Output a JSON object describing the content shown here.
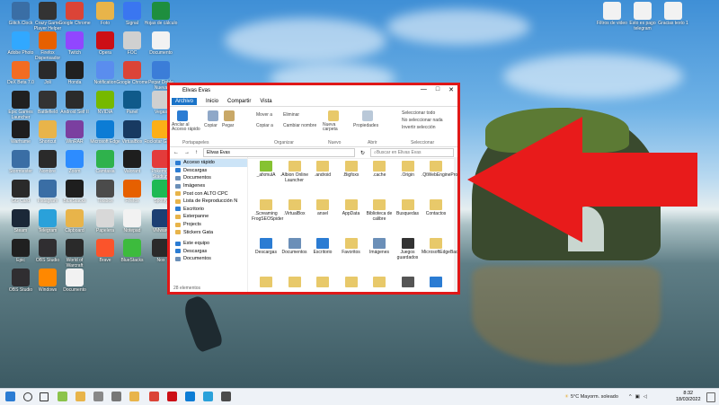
{
  "desktop": {
    "icons": [
      {
        "label": "Glitch.Clock",
        "color": "#3a6ea5"
      },
      {
        "label": "Crazy Game Player Helper",
        "color": "#333333"
      },
      {
        "label": "Google Chrome",
        "color": "#db4437"
      },
      {
        "label": "Foto",
        "color": "#e8b44a"
      },
      {
        "label": "Signal",
        "color": "#3a76f0"
      },
      {
        "label": "Hojas de cálculo",
        "color": "#1e8e3e"
      },
      {
        "label": "Adobe Photo",
        "color": "#31a8ff"
      },
      {
        "label": "Firefox Dispensador",
        "color": "#e66000"
      },
      {
        "label": "Twitch",
        "color": "#9146ff"
      },
      {
        "label": "Opera",
        "color": "#cc0f16"
      },
      {
        "label": "FOC",
        "color": "#d0d0d0"
      },
      {
        "label": "Documento",
        "color": "#f2f2f2"
      },
      {
        "label": "DeX Beta 7.0",
        "color": "#f26c22"
      },
      {
        "label": "Joli",
        "color": "#2a2a2a"
      },
      {
        "label": "Honda",
        "color": "#202020"
      },
      {
        "label": "Notification",
        "color": "#5a8dee"
      },
      {
        "label": "Google Chrome",
        "color": "#db4437"
      },
      {
        "label": "Pegar Doble Nueva",
        "color": "#3b7dd8"
      },
      {
        "label": "Epic Games Launcher",
        "color": "#202020"
      },
      {
        "label": "Battlefield",
        "color": "#333333"
      },
      {
        "label": "Android Self II",
        "color": "#2b2b2b"
      },
      {
        "label": "NVIDIA",
        "color": "#76b900"
      },
      {
        "label": "Panel",
        "color": "#0f5a8a"
      },
      {
        "label": "Vegas",
        "color": "#d0d0d0"
      },
      {
        "label": "Warframe",
        "color": "#1e1e1e"
      },
      {
        "label": "Shortcut",
        "color": "#e8b44a"
      },
      {
        "label": "WinRAR",
        "color": "#7b3fa0"
      },
      {
        "label": "Microsoft Edge",
        "color": "#0c7cd5"
      },
      {
        "label": "VirtualBox",
        "color": "#183a61"
      },
      {
        "label": "Rockstar Games",
        "color": "#fcaf17"
      },
      {
        "label": "Stormtester",
        "color": "#3a6ea5"
      },
      {
        "label": "Nombre",
        "color": "#2a2a2a"
      },
      {
        "label": "Zoom",
        "color": "#2d8cff"
      },
      {
        "label": "Camtasia",
        "color": "#2fb24c"
      },
      {
        "label": "Valorant",
        "color": "#1e1e1e"
      },
      {
        "label": "Pokemon Stadium",
        "color": "#e33b3b"
      },
      {
        "label": "GG Card",
        "color": "#2a2a2a"
      },
      {
        "label": "Instagram",
        "color": "#3a6ea5"
      },
      {
        "label": "BlueStacks",
        "color": "#1e1e1e"
      },
      {
        "label": "Toolbox",
        "color": "#4b4b4b"
      },
      {
        "label": "Firefox",
        "color": "#e66000"
      },
      {
        "label": "Spotify",
        "color": "#1db954"
      },
      {
        "label": "Steam",
        "color": "#1b2838"
      },
      {
        "label": "Telegram",
        "color": "#2aa1da"
      },
      {
        "label": "Clipboard",
        "color": "#e8b44a"
      },
      {
        "label": "Papelera",
        "color": "#d8d8d8"
      },
      {
        "label": "Notepad",
        "color": "#f2f2f2"
      },
      {
        "label": "VMware",
        "color": "#1c3f73"
      },
      {
        "label": "Epic",
        "color": "#202020"
      },
      {
        "label": "OBS Studio",
        "color": "#302e31"
      },
      {
        "label": "World of Warcraft",
        "color": "#2a2a2a"
      },
      {
        "label": "Brave",
        "color": "#fb542b"
      },
      {
        "label": "BlueStacks",
        "color": "#3dbb3d"
      },
      {
        "label": "Nox",
        "color": "#2a2a2a"
      },
      {
        "label": "OBS Studio",
        "color": "#302e31"
      },
      {
        "label": "Windows",
        "color": "#ff8800"
      },
      {
        "label": "Documento",
        "color": "#f2f2f2"
      }
    ],
    "right_icons": [
      {
        "label": "Filtros de video",
        "color": "#f2f2f2"
      },
      {
        "label": "Esto es pago telegram",
        "color": "#f2f2f2"
      },
      {
        "label": "Gracias texto 1",
        "color": "#f2f2f2"
      }
    ]
  },
  "explorer": {
    "title": "Elivas Evas",
    "tabs": [
      "Archivo",
      "Inicio",
      "Compartir",
      "Vista"
    ],
    "ribbon": {
      "pin": "Anclar al Acceso rápido",
      "copy": "Copiar",
      "paste": "Pegar",
      "move_to": "Mover a",
      "copy_to": "Copiar a",
      "delete": "Eliminar",
      "rename": "Cambiar nombre",
      "new_folder": "Nueva carpeta",
      "properties": "Propiedades",
      "select_all": "Seleccionar todo",
      "select_none": "No seleccionar nada",
      "invert": "Invertir selección",
      "groups": [
        "Portapapeles",
        "Organizar",
        "Nuevo",
        "Abrir",
        "Seleccionar"
      ]
    },
    "address": "Elivas Evas",
    "search_placeholder": "Buscar en Elivas Evas",
    "nav": [
      {
        "label": "Acceso rápido",
        "color": "#2b7cd3"
      },
      {
        "label": "Descargas",
        "color": "#2b7cd3"
      },
      {
        "label": "Documentos",
        "color": "#6b8fb8"
      },
      {
        "label": "Imágenes",
        "color": "#6b8fb8"
      },
      {
        "label": "Post con ALTO CPC",
        "color": "#e8b44a"
      },
      {
        "label": "Lista de Reproducción N",
        "color": "#e8b44a"
      },
      {
        "label": "Escritorio",
        "color": "#2b7cd3"
      },
      {
        "label": "Esterpanne",
        "color": "#e8b44a"
      },
      {
        "label": "Projects",
        "color": "#e8b44a"
      },
      {
        "label": "Stickers Gata",
        "color": "#e8b44a"
      },
      {
        "label": "Este equipo",
        "color": "#2b7cd3"
      },
      {
        "label": "Descargas",
        "color": "#2b7cd3"
      },
      {
        "label": "Documentos",
        "color": "#6b8fb8"
      }
    ],
    "files": [
      {
        "label": "_afxmulA",
        "color": "#86c232"
      },
      {
        "label": ".Albion Online Launcher",
        "color": "#e8c96a"
      },
      {
        "label": ".android",
        "color": "#e8c96a"
      },
      {
        "label": ".Bigfoxx",
        "color": "#e8c96a"
      },
      {
        "label": ".cache",
        "color": "#e8c96a"
      },
      {
        "label": ".Origin",
        "color": "#e8c96a"
      },
      {
        "label": ".QtWebEngineProcess",
        "color": "#e8c96a"
      },
      {
        "label": ".Screaming FrogSEOSpider",
        "color": "#e8c96a"
      },
      {
        "label": ".VirtualBox",
        "color": "#e8c96a"
      },
      {
        "label": "ansel",
        "color": "#e8c96a"
      },
      {
        "label": "AppData",
        "color": "#e8c96a"
      },
      {
        "label": "Biblioteca de calibre",
        "color": "#e8c96a"
      },
      {
        "label": "Busquedas",
        "color": "#e8c96a"
      },
      {
        "label": "Contactos",
        "color": "#e8c96a"
      },
      {
        "label": "Descargas",
        "color": "#2b7cd3"
      },
      {
        "label": "Documentos",
        "color": "#6b8fb8"
      },
      {
        "label": "Escritorio",
        "color": "#2b7cd3"
      },
      {
        "label": "Favoritos",
        "color": "#e8c96a"
      },
      {
        "label": "Imágenes",
        "color": "#6b8fb8"
      },
      {
        "label": "Juegos guardados",
        "color": "#333333"
      },
      {
        "label": "MicrosoftEdgeBackups",
        "color": "#e8c96a"
      },
      {
        "label": "",
        "color": "#e8c96a"
      },
      {
        "label": "",
        "color": "#e8c96a"
      },
      {
        "label": "",
        "color": "#e8c96a"
      },
      {
        "label": "",
        "color": "#e8c96a"
      },
      {
        "label": "",
        "color": "#e8c96a"
      },
      {
        "label": "",
        "color": "#555555"
      },
      {
        "label": "",
        "color": "#2b7cd3"
      }
    ],
    "status": "28 elementos"
  },
  "taskbar": {
    "icons": [
      {
        "name": "start-icon",
        "color": "#2b7cd3"
      },
      {
        "name": "search-icon",
        "color": "#333333"
      },
      {
        "name": "task-view-icon",
        "color": "#333333"
      },
      {
        "name": "app-1-icon",
        "color": "#8bc34a"
      },
      {
        "name": "app-2-icon",
        "color": "#e8b44a"
      },
      {
        "name": "app-3-icon",
        "color": "#888888"
      },
      {
        "name": "app-4-icon",
        "color": "#777777"
      },
      {
        "name": "app-5-icon",
        "color": "#e8b44a"
      },
      {
        "name": "chrome-icon",
        "color": "#db4437"
      },
      {
        "name": "opera-icon",
        "color": "#cc0f16"
      },
      {
        "name": "edge-icon",
        "color": "#0c7cd5"
      },
      {
        "name": "telegram-icon",
        "color": "#2aa1da"
      },
      {
        "name": "app-6-icon",
        "color": "#4b4b4b"
      }
    ],
    "weather": "5°C Mayorm. soleado",
    "time": "8:32",
    "date": "18/03/2022"
  },
  "colors": {
    "highlight_border": "#e01818",
    "arrow": "#e81b1b"
  }
}
